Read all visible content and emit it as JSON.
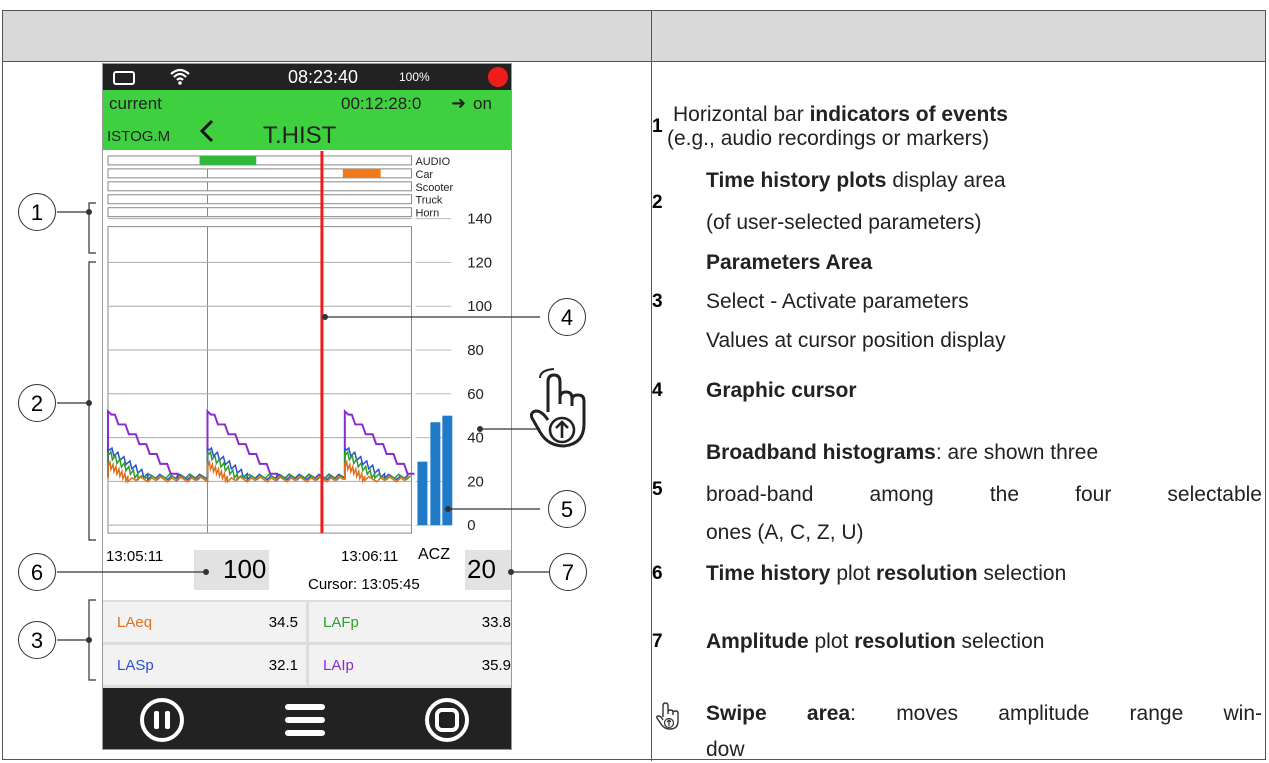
{
  "device": {
    "clock": "08:23:40",
    "battery_pct": "100%",
    "mode": "current",
    "elapsed": "00:12:28:0",
    "arrow": "➜",
    "state": "on",
    "view_left": "ISTOG.M",
    "view_title": "T.HIST",
    "event_labels": [
      "AUDIO",
      "Car",
      "Scooter",
      "Truck",
      "Horn"
    ],
    "y_ticks": [
      "140",
      "120",
      "100",
      "80",
      "60",
      "40",
      "20",
      "0"
    ],
    "time_start": "13:05:11",
    "time_end": "13:06:11",
    "hist_letters": "ACZ",
    "time_resolution": "100",
    "amp_resolution": "20",
    "cursor_time": "Cursor: 13:05:45",
    "params": [
      {
        "name": "LAeq",
        "value": "34.5",
        "color": "#e07020"
      },
      {
        "name": "LAFp",
        "value": "33.8",
        "color": "#2e9e2e"
      },
      {
        "name": "LASp",
        "value": "32.1",
        "color": "#2b4fd0"
      },
      {
        "name": "LAIp",
        "value": "35.9",
        "color": "#8a2bd0"
      }
    ],
    "histogram": {
      "A": 29,
      "C": 47,
      "Z": 50
    },
    "buttons": [
      "pause-button",
      "menu-button",
      "stop-button"
    ]
  },
  "callouts": [
    "1",
    "2",
    "3",
    "4",
    "5",
    "6",
    "7"
  ],
  "legend": {
    "i1_num": "1",
    "i1_l1a": "Horizontal bar ",
    "i1_l1b": "indicators of events",
    "i1_l2": "(e.g., audio recordings or markers)",
    "i2_num": "2",
    "i2_l1a": "Time history plots",
    "i2_l1b": " display area",
    "i2_l2": "(of user-selected parameters)",
    "i3_head": "Parameters Area",
    "i3_num": "3",
    "i3_l1": "Select - Activate parameters",
    "i3_l2": "Values at cursor position display",
    "i4_num": "4",
    "i4_text": "Graphic cursor",
    "i5_head_b": "Broadband histograms",
    "i5_head_r": ": are shown three",
    "i5_num": "5",
    "i5_l1": "broad-band among the four selectable",
    "i5_l2": "ones (A, C, Z, U)",
    "i6_num": "6",
    "i6_b1": "Time history",
    "i6_r1": " plot ",
    "i6_b2": "resolution",
    "i6_r2": " selection",
    "i7_num": "7",
    "i7_b1": "Amplitude",
    "i7_r1": " plot ",
    "i7_b2": "resolution",
    "i7_r2": " selection",
    "swipe_b": "Swipe area",
    "swipe_r": ": moves amplitude range win-",
    "swipe_l2": "dow"
  }
}
